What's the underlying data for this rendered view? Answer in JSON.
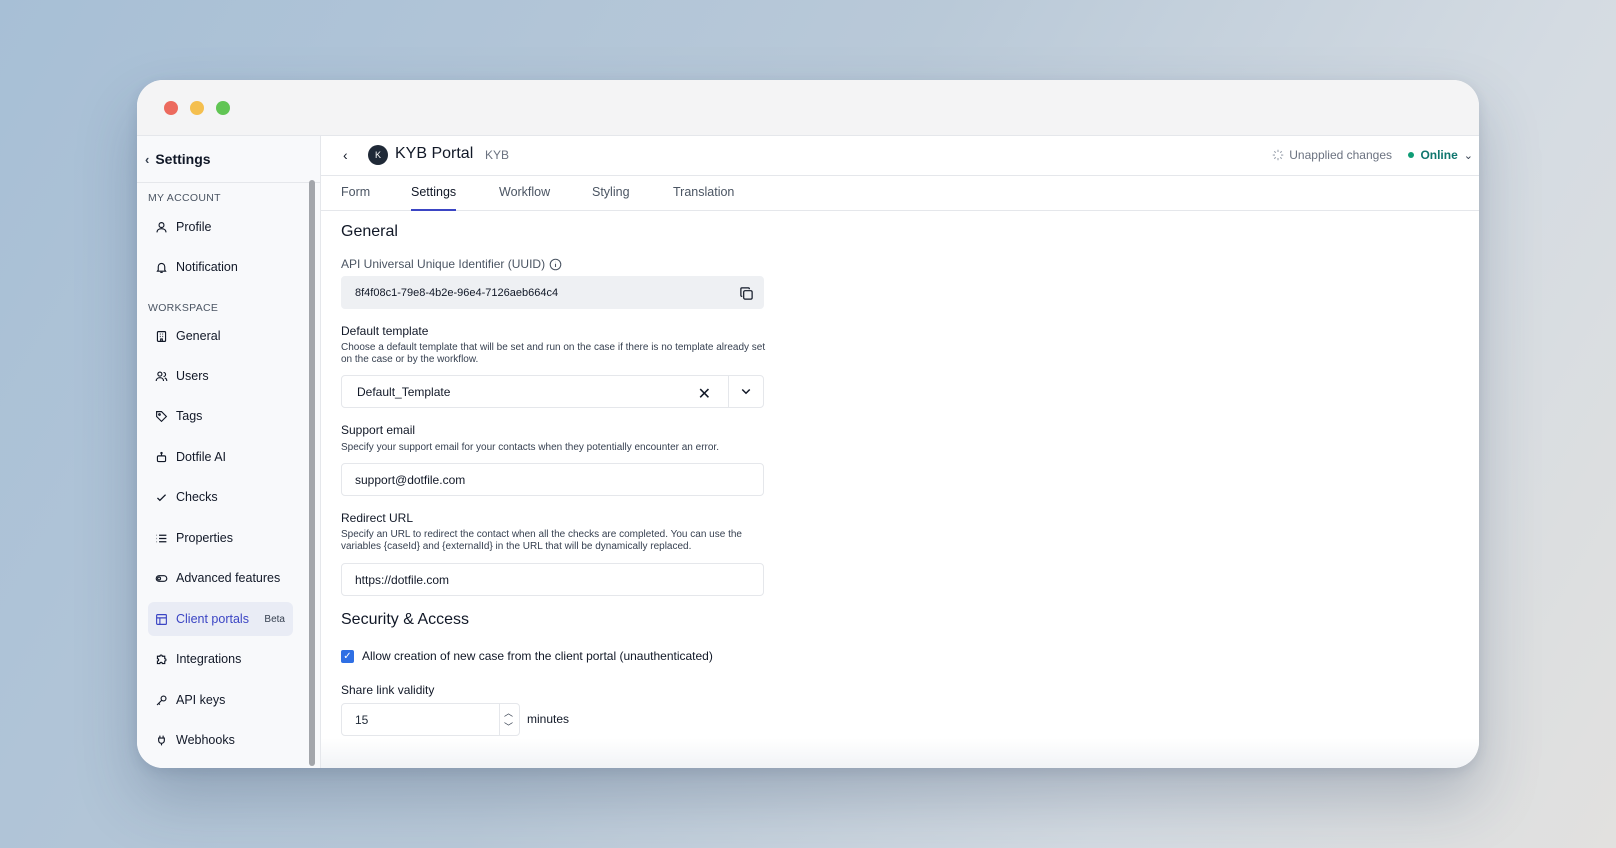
{
  "sidebar": {
    "back_label": "Settings",
    "sections": {
      "my_account": "MY ACCOUNT",
      "workspace": "WORKSPACE"
    },
    "items": [
      {
        "label": "Profile",
        "icon": "user-icon"
      },
      {
        "label": "Notification",
        "icon": "bell-icon"
      },
      {
        "label": "General",
        "icon": "building-icon"
      },
      {
        "label": "Users",
        "icon": "users-icon"
      },
      {
        "label": "Tags",
        "icon": "tag-icon"
      },
      {
        "label": "Dotfile AI",
        "icon": "robot-icon"
      },
      {
        "label": "Checks",
        "icon": "check-icon"
      },
      {
        "label": "Properties",
        "icon": "list-icon"
      },
      {
        "label": "Advanced features",
        "icon": "toggle-icon"
      },
      {
        "label": "Client portals",
        "icon": "layout-icon",
        "badge": "Beta",
        "active": true
      },
      {
        "label": "Integrations",
        "icon": "puzzle-icon"
      },
      {
        "label": "API keys",
        "icon": "key-icon"
      },
      {
        "label": "Webhooks",
        "icon": "plug-icon"
      }
    ]
  },
  "header": {
    "avatar_letter": "K",
    "title": "KYB Portal",
    "tag": "KYB",
    "unapplied": "Unapplied changes",
    "status": "Online"
  },
  "tabs": [
    "Form",
    "Settings",
    "Workflow",
    "Styling",
    "Translation"
  ],
  "active_tab": "Settings",
  "general": {
    "heading": "General",
    "uuid_label": "API Universal Unique Identifier (UUID)",
    "uuid_value": "8f4f08c1-79e8-4b2e-96e4-7126aeb664c4",
    "default_template_label": "Default template",
    "default_template_help": "Choose a default template that will be set and run on the case if there is no template already set on the case or by the workflow.",
    "default_template_value": "Default_Template",
    "support_email_label": "Support email",
    "support_email_help": "Specify your support email for your contacts when they potentially encounter an error.",
    "support_email_value": "support@dotfile.com",
    "redirect_label": "Redirect URL",
    "redirect_help": "Specify an URL to redirect the contact when all the checks are completed. You can use the variables {caseId} and {externalId} in the URL that will be dynamically replaced.",
    "redirect_value": "https://dotfile.com"
  },
  "security": {
    "heading": "Security & Access",
    "allow_creation_label": "Allow creation of new case from the client portal (unauthenticated)",
    "allow_creation_checked": true,
    "share_link_label": "Share link validity",
    "share_link_value": "15",
    "share_link_unit": "minutes"
  },
  "colors": {
    "accent": "#3b45c4",
    "online": "#0f766e",
    "checkbox": "#2f6fe4"
  }
}
